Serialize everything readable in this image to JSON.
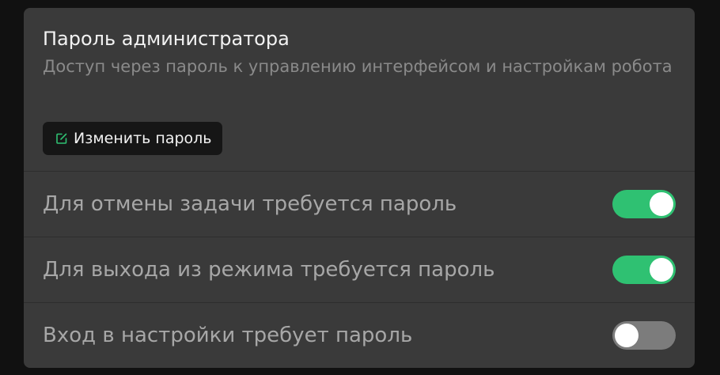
{
  "card": {
    "title": "Пароль администратора",
    "description": "Доступ через пароль к управлению интерфейсом и настройкам робота",
    "change_password_label": "Изменить пароль"
  },
  "settings": [
    {
      "label": "Для отмены задачи требуется пароль",
      "enabled": true
    },
    {
      "label": "Для выхода из режима требуется пароль",
      "enabled": true
    },
    {
      "label": "Вход в настройки требует пароль",
      "enabled": false
    }
  ],
  "colors": {
    "toggle_on": "#2fc172",
    "toggle_off": "#7c7c7c",
    "edit_icon": "#2fc172"
  },
  "icons": {
    "change_password": "edit-icon"
  }
}
